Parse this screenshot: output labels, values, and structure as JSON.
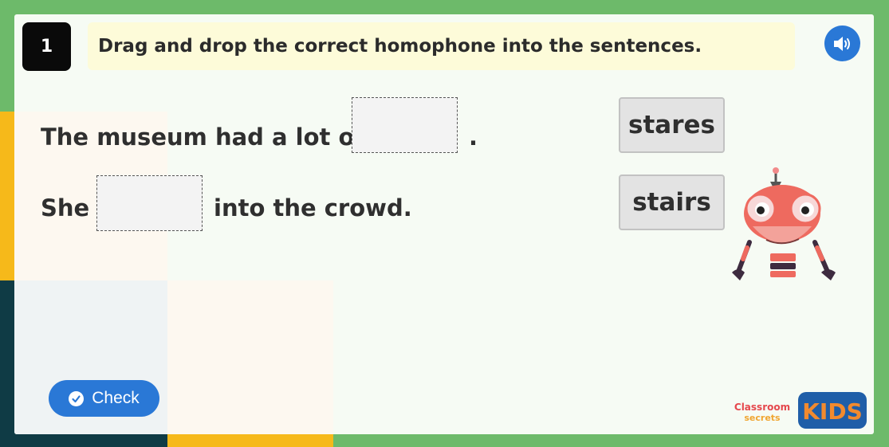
{
  "question": {
    "number": "1",
    "instruction": "Drag and drop the correct homophone into the sentences."
  },
  "audio": {
    "icon": "speaker-icon"
  },
  "sentences": [
    {
      "before": "The museum had a lot of",
      "after": "."
    },
    {
      "before": "She",
      "after": "into the crowd."
    }
  ],
  "choices": [
    "stares",
    "stairs"
  ],
  "check": {
    "label": "Check",
    "icon": "check-circle-icon"
  },
  "branding": {
    "logo_classroom_line1": "Classroom",
    "logo_classroom_line2": "secrets",
    "logo_kids": "KIDS"
  },
  "colors": {
    "background": "#6dba6a",
    "accent_blue": "#2a78d6",
    "instruction_bg": "#fdfbd9",
    "tile_bg": "#e3e3e3"
  }
}
